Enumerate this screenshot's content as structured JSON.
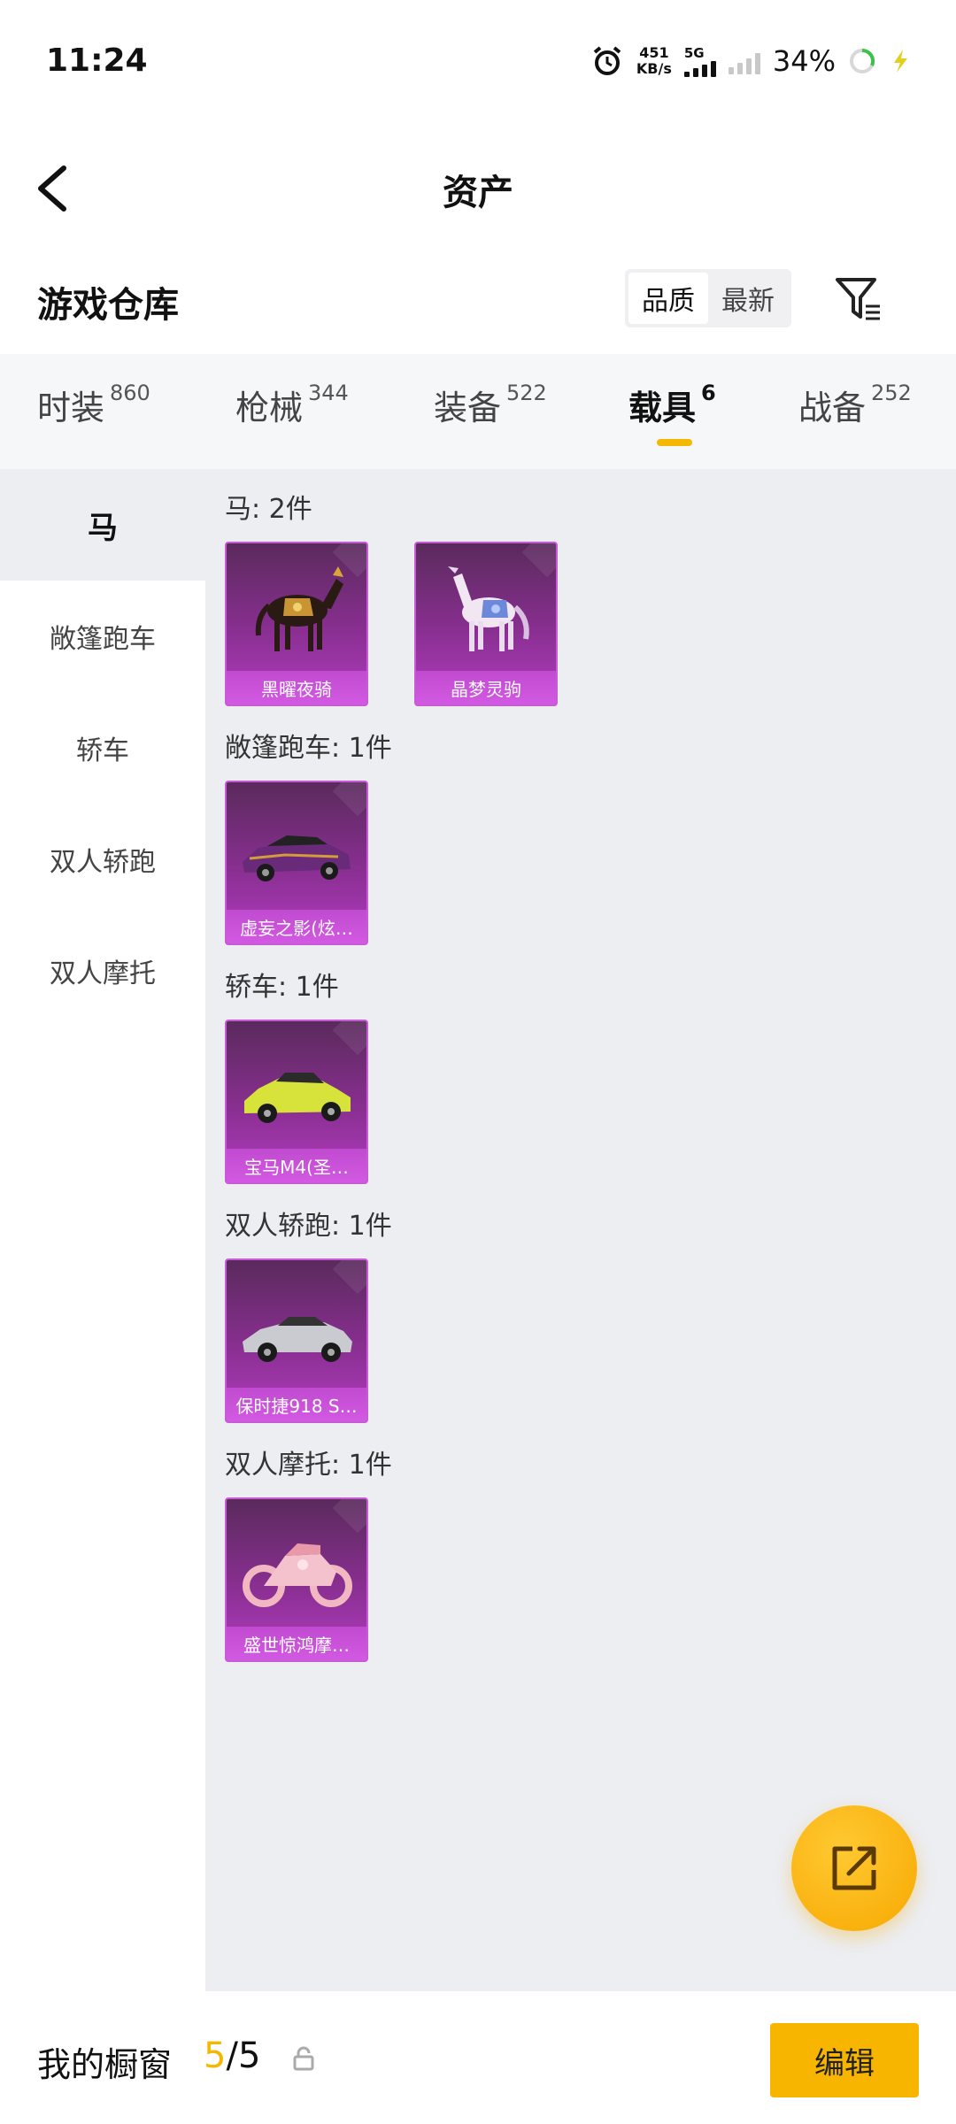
{
  "status_bar": {
    "time": "11:24",
    "net_speed_value": "451",
    "net_speed_unit": "KB/s",
    "network_gen": "5G",
    "battery_percent": "34%"
  },
  "header": {
    "title": "资产"
  },
  "warehouse": {
    "title": "游戏仓库",
    "sort_options": [
      "品质",
      "最新"
    ],
    "sort_selected": "品质"
  },
  "tabs": [
    {
      "label": "时装",
      "count": "860",
      "active": false
    },
    {
      "label": "枪械",
      "count": "344",
      "active": false
    },
    {
      "label": "装备",
      "count": "522",
      "active": false
    },
    {
      "label": "载具",
      "count": "6",
      "active": true
    },
    {
      "label": "战备",
      "count": "252",
      "active": false
    }
  ],
  "side_nav": [
    {
      "label": "马",
      "active": true
    },
    {
      "label": "敞篷跑车",
      "active": false
    },
    {
      "label": "轿车",
      "active": false
    },
    {
      "label": "双人轿跑",
      "active": false
    },
    {
      "label": "双人摩托",
      "active": false
    }
  ],
  "groups": [
    {
      "title": "马: 2件",
      "items": [
        {
          "name": "黑曜夜骑",
          "icon": "dark-horse-icon"
        },
        {
          "name": "晶梦灵驹",
          "icon": "crystal-horse-icon"
        }
      ]
    },
    {
      "title": "敞篷跑车: 1件",
      "items": [
        {
          "name": "虚妄之影(炫…",
          "icon": "convertible-car-icon"
        }
      ]
    },
    {
      "title": "轿车: 1件",
      "items": [
        {
          "name": "宝马M4(圣…",
          "icon": "sedan-car-icon"
        }
      ]
    },
    {
      "title": "双人轿跑: 1件",
      "items": [
        {
          "name": "保时捷918 S…",
          "icon": "coupe-car-icon"
        }
      ]
    },
    {
      "title": "双人摩托: 1件",
      "items": [
        {
          "name": "盛世惊鸿摩…",
          "icon": "motorcycle-icon"
        }
      ]
    }
  ],
  "bottom_bar": {
    "showcase_label": "我的橱窗",
    "showcase_current": "5",
    "showcase_sep": "/",
    "showcase_total": "5",
    "edit_label": "编辑"
  },
  "colors": {
    "accent": "#f5b800",
    "card_purple": "#8a2f92",
    "content_bg": "#eceef2"
  }
}
